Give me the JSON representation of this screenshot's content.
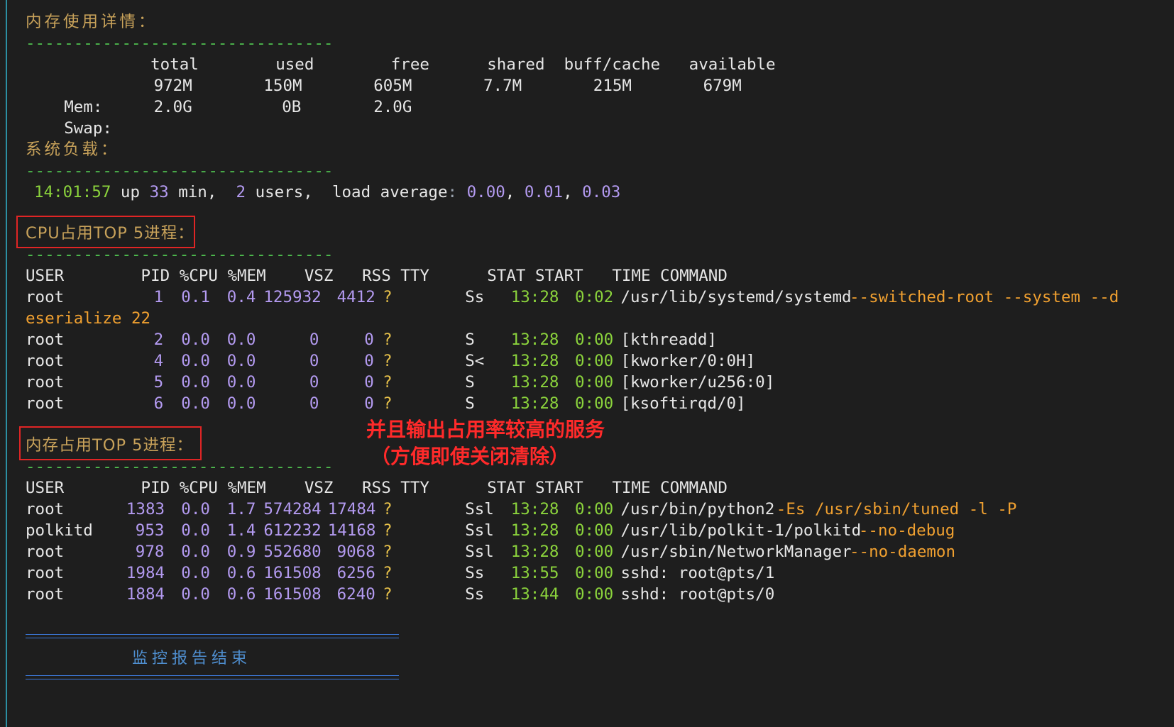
{
  "colors": {
    "background": "#1e1e1e",
    "header": "#c8a25a",
    "dashes": "#4fbf4f",
    "number": "#b39af0",
    "time": "#8bd33c",
    "option": "#f0a030",
    "annotation": "#ff2a2a",
    "end_line": "#3c78d8"
  },
  "sections": {
    "memory_title": "内存使用详情：",
    "load_title": "系统负载：",
    "cpu_top_title": "CPU占用TOP 5进程：",
    "mem_top_title": "内存占用TOP 5进程：",
    "separator": "--------------------------------",
    "end_title": "监控报告结束"
  },
  "memory": {
    "header": "             total        used        free      shared  buff/cache   available",
    "mem_label": "Mem:",
    "mem_values": [
      "972M",
      "150M",
      "605M",
      "7.7M",
      "215M",
      "679M"
    ],
    "swap_label": "Swap:",
    "swap_values": [
      "2.0G",
      "0B",
      "2.0G"
    ]
  },
  "load": {
    "time": "14:01:57",
    "up": "up",
    "minutes": "33",
    "min_label": "min,",
    "users": "2",
    "users_label": "users,",
    "load_label": "load average",
    "averages": [
      "0.00",
      "0.01",
      "0.03"
    ]
  },
  "ps_header": "USER        PID %CPU %MEM    VSZ   RSS TTY      STAT START   TIME COMMAND",
  "cpu_top": [
    {
      "user": "root",
      "pid": "1",
      "cpu": "0.1",
      "mem": "0.4",
      "vsz": "125932",
      "rss": "4412",
      "tty": "?",
      "stat": "Ss",
      "start": "13:28",
      "time": "0:02",
      "cmd": "/usr/lib/systemd/systemd",
      "args": "--switched-root --system --d",
      "wrap": "eserialize 22"
    },
    {
      "user": "root",
      "pid": "2",
      "cpu": "0.0",
      "mem": "0.0",
      "vsz": "0",
      "rss": "0",
      "tty": "?",
      "stat": "S",
      "start": "13:28",
      "time": "0:00",
      "cmd": "[kthreadd]",
      "args": ""
    },
    {
      "user": "root",
      "pid": "4",
      "cpu": "0.0",
      "mem": "0.0",
      "vsz": "0",
      "rss": "0",
      "tty": "?",
      "stat": "S<",
      "start": "13:28",
      "time": "0:00",
      "cmd": "[kworker/0:0H]",
      "args": ""
    },
    {
      "user": "root",
      "pid": "5",
      "cpu": "0.0",
      "mem": "0.0",
      "vsz": "0",
      "rss": "0",
      "tty": "?",
      "stat": "S",
      "start": "13:28",
      "time": "0:00",
      "cmd": "[kworker/u256:0]",
      "args": ""
    },
    {
      "user": "root",
      "pid": "6",
      "cpu": "0.0",
      "mem": "0.0",
      "vsz": "0",
      "rss": "0",
      "tty": "?",
      "stat": "S",
      "start": "13:28",
      "time": "0:00",
      "cmd": "[ksoftirqd/0]",
      "args": ""
    }
  ],
  "mem_top": [
    {
      "user": "root",
      "pid": "1383",
      "cpu": "0.0",
      "mem": "1.7",
      "vsz": "574284",
      "rss": "17484",
      "tty": "?",
      "stat": "Ssl",
      "start": "13:28",
      "time": "0:00",
      "cmd": "/usr/bin/python2",
      "args": "-Es /usr/sbin/tuned -l -P"
    },
    {
      "user": "polkitd",
      "pid": "953",
      "cpu": "0.0",
      "mem": "1.4",
      "vsz": "612232",
      "rss": "14168",
      "tty": "?",
      "stat": "Ssl",
      "start": "13:28",
      "time": "0:00",
      "cmd": "/usr/lib/polkit-1/polkitd",
      "args": "--no-debug"
    },
    {
      "user": "root",
      "pid": "978",
      "cpu": "0.0",
      "mem": "0.9",
      "vsz": "552680",
      "rss": "9068",
      "tty": "?",
      "stat": "Ssl",
      "start": "13:28",
      "time": "0:00",
      "cmd": "/usr/sbin/NetworkManager",
      "args": "--no-daemon"
    },
    {
      "user": "root",
      "pid": "1984",
      "cpu": "0.0",
      "mem": "0.6",
      "vsz": "161508",
      "rss": "6256",
      "tty": "?",
      "stat": "Ss",
      "start": "13:55",
      "time": "0:00",
      "cmd": "sshd: root@pts/1",
      "args": ""
    },
    {
      "user": "root",
      "pid": "1884",
      "cpu": "0.0",
      "mem": "0.6",
      "vsz": "161508",
      "rss": "6240",
      "tty": "?",
      "stat": "Ss",
      "start": "13:44",
      "time": "0:00",
      "cmd": "sshd: root@pts/0",
      "args": ""
    }
  ],
  "annotation": {
    "line1": "并且输出占用率较高的服务",
    "line2": "（方便即使关闭清除）"
  }
}
